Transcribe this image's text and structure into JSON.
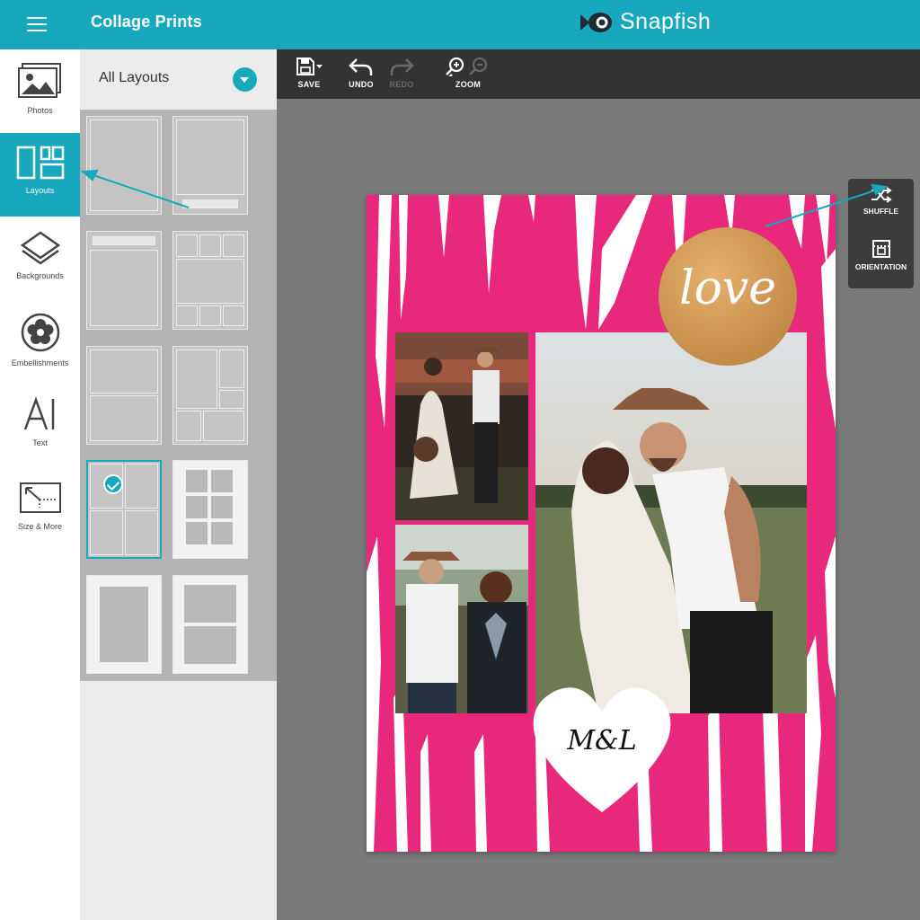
{
  "header": {
    "title": "Collage Prints",
    "brand": "Snapfish"
  },
  "leftnav": {
    "items": [
      {
        "label": "Photos",
        "icon": "photos-icon",
        "active": false
      },
      {
        "label": "Layouts",
        "icon": "layouts-icon",
        "active": true
      },
      {
        "label": "Backgrounds",
        "icon": "backgrounds-icon",
        "active": false
      },
      {
        "label": "Embellishments",
        "icon": "embellishments-icon",
        "active": false
      },
      {
        "label": "Text",
        "icon": "text-icon",
        "active": false
      },
      {
        "label": "Size & More",
        "icon": "size-icon",
        "active": false
      }
    ]
  },
  "panel": {
    "dropdown_label": "All Layouts",
    "selected_layout": 7
  },
  "toolbar": {
    "save": "SAVE",
    "undo": "UNDO",
    "redo": "REDO",
    "zoom": "ZOOM"
  },
  "sidetools": {
    "shuffle": "SHUFFLE",
    "orientation": "ORIENTATION"
  },
  "collage": {
    "sticker_text": "love",
    "heart_text": "M&L"
  },
  "colors": {
    "accent": "#17a8bd",
    "page_bg": "#e8287b",
    "toolbar": "#333333"
  }
}
